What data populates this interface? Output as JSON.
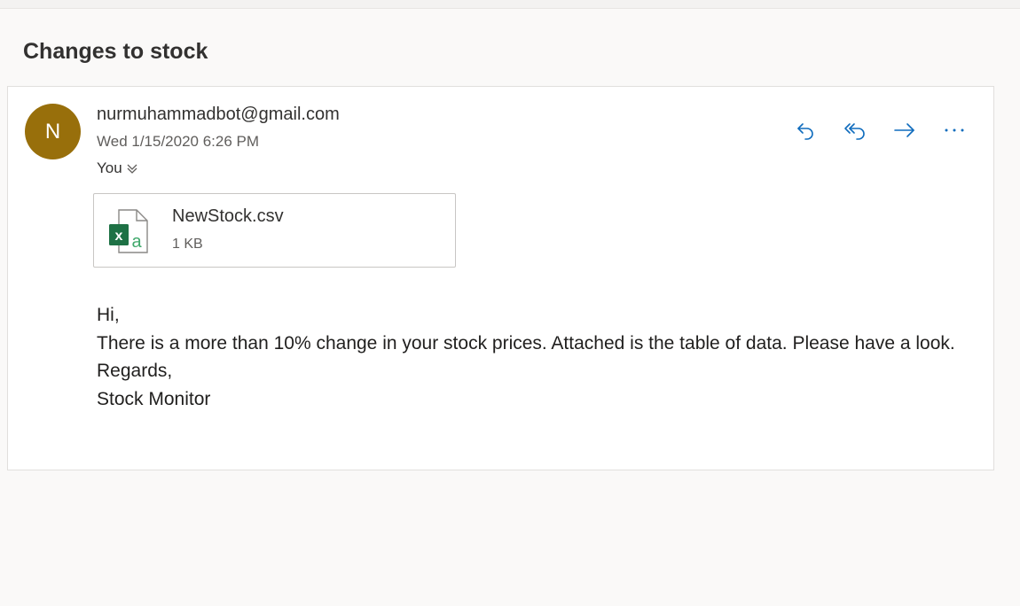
{
  "message": {
    "subject": "Changes to stock",
    "avatar_initial": "N",
    "sender": "nurmuhammadbot@gmail.com",
    "date": "Wed 1/15/2020 6:26 PM",
    "to": "You"
  },
  "actions": [
    {
      "name": "reply-icon"
    },
    {
      "name": "reply-all-icon"
    },
    {
      "name": "forward-icon"
    },
    {
      "name": "more-options-icon"
    }
  ],
  "attachment": {
    "file_name": "NewStock.csv",
    "file_size": "1 KB",
    "icon": "excel-csv-file-icon"
  },
  "body": {
    "greeting": "Hi,",
    "line1": "There is a more than 10% change in your stock prices. Attached is the table of data. Please have a look.",
    "closing": "Regards,",
    "signature": "Stock Monitor"
  },
  "colors": {
    "avatar": "#986f0b",
    "action_blue": "#0f6cbd",
    "excel_green": "#1e7145"
  }
}
